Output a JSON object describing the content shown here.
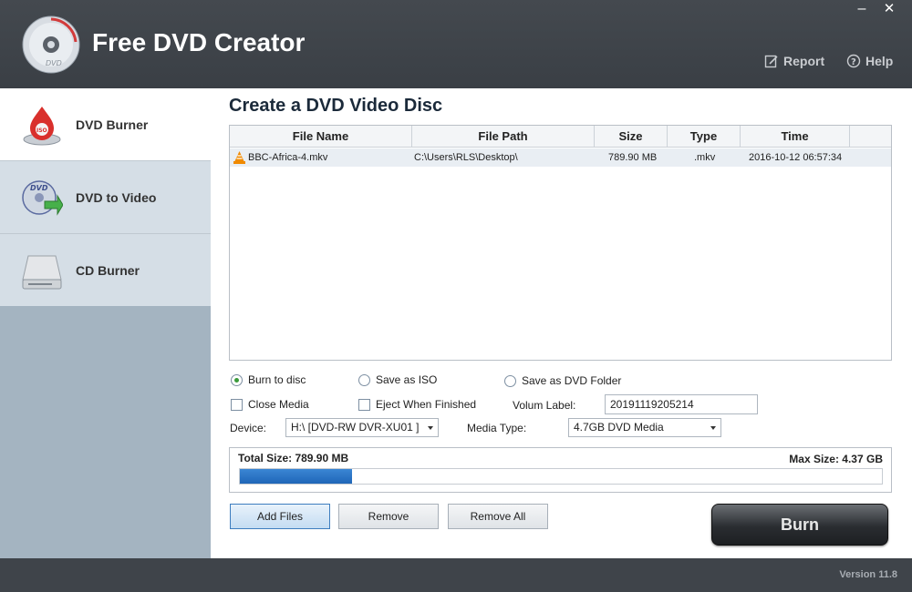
{
  "app": {
    "title": "Free DVD Creator",
    "version": "Version 11.8"
  },
  "window": {
    "minimize_label": "–",
    "close_label": "✕"
  },
  "header": {
    "report_label": "Report",
    "help_label": "Help"
  },
  "sidebar": {
    "items": [
      {
        "label": "DVD Burner",
        "icon": "dvd-burner-icon",
        "active": true
      },
      {
        "label": "DVD to Video",
        "icon": "dvd-to-video-icon",
        "active": false
      },
      {
        "label": "CD Burner",
        "icon": "cd-burner-icon",
        "active": false
      }
    ]
  },
  "main": {
    "title": "Create a DVD Video Disc",
    "table": {
      "columns": [
        "File Name",
        "File Path",
        "Size",
        "Type",
        "Time"
      ],
      "rows": [
        {
          "file_name": "BBC-Africa-4.mkv",
          "file_path": "C:\\Users\\RLS\\Desktop\\",
          "size": "789.90 MB",
          "type": ".mkv",
          "time": "2016-10-12 06:57:34"
        }
      ]
    },
    "options": {
      "burn_to_disc": "Burn to disc",
      "save_as_iso": "Save as ISO",
      "save_as_dvd_folder": "Save as DVD Folder",
      "selected": "burn_to_disc",
      "close_media": "Close Media",
      "eject_when_finished": "Eject When Finished",
      "volum_label_text": "Volum Label:",
      "volum_label_value": "20191119205214",
      "device_text": "Device:",
      "device_value": "H:\\ [DVD-RW DVR-XU01 ]",
      "media_type_text": "Media Type:",
      "media_type_value": "4.7GB DVD Media"
    },
    "size": {
      "total_size": "Total Size: 789.90 MB",
      "max_size": "Max Size: 4.37 GB",
      "used_fraction": 0.175
    },
    "buttons": {
      "add_files": "Add Files",
      "remove": "Remove",
      "remove_all": "Remove All",
      "burn": "Burn"
    }
  },
  "colors": {
    "header_bg": "#3f444a",
    "sidebar_bg": "#d5dee6",
    "sidebar_filler": "#a4b4c1",
    "progress_fill": "#1f66b8",
    "radio_checked": "#3a9a3a"
  }
}
